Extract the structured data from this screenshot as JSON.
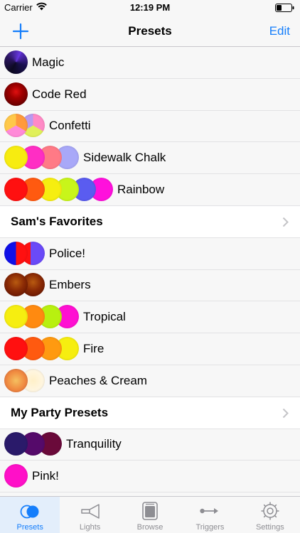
{
  "status_bar": {
    "carrier": "Carrier",
    "time": "12:19 PM"
  },
  "nav": {
    "title": "Presets",
    "edit_label": "Edit"
  },
  "colors": {
    "accent": "#157efb",
    "inactive": "#8e8e93"
  },
  "presets": [
    {
      "name": "Magic",
      "kind": "preset",
      "swatches": [
        {
          "css": "conic-gradient(from 30deg, #5a2cc6 0deg, #1a1050 80deg, #0d0a22 180deg, #2a155e 270deg, #6a3ae6 360deg)"
        }
      ]
    },
    {
      "name": "Code Red",
      "kind": "preset",
      "swatches": [
        {
          "css": "radial-gradient(circle at 50% 40%, #e01010 0%, #a00000 35%, #4a0000 100%)"
        }
      ]
    },
    {
      "name": "Confetti",
      "kind": "preset",
      "swatches": [
        {
          "css": "conic-gradient(#ff9a3c 0deg 120deg, #ff8ad8 120deg 240deg, #ffc84a 240deg 360deg)"
        },
        {
          "css": "conic-gradient(#ff8ac6 0deg 120deg, #e0f05a 120deg 240deg, #b89af0 240deg 360deg)"
        }
      ]
    },
    {
      "name": "Sidewalk Chalk",
      "kind": "preset",
      "swatches": [
        {
          "css": "#f7ec10"
        },
        {
          "css": "#ff2ec4"
        },
        {
          "css": "#ff7a86"
        },
        {
          "css": "#a8a8f8"
        }
      ]
    },
    {
      "name": "Rainbow",
      "kind": "preset",
      "swatches": [
        {
          "css": "#ff1010"
        },
        {
          "css": "#ff5a10"
        },
        {
          "css": "#f6ee10"
        },
        {
          "css": "#c8f51a"
        },
        {
          "css": "#5a5cf0"
        },
        {
          "css": "#ff10dc"
        }
      ]
    },
    {
      "name": "Sam's Favorites",
      "kind": "group"
    },
    {
      "name": "Police!",
      "kind": "preset",
      "swatches": [
        {
          "css": "linear-gradient(90deg, #1010e8 0%, #1010e8 50%, #ff1010 50%, #ff1010 100%)"
        },
        {
          "css": "linear-gradient(90deg, #ff1010 0%, #ff1010 40%, #6a4af8 40%, #6a4af8 100%)"
        }
      ]
    },
    {
      "name": "Embers",
      "kind": "preset",
      "swatches": [
        {
          "css": "radial-gradient(circle at 50% 40%, #b85a10 0%, #8a2a05 45%, #5a0f02 100%)"
        },
        {
          "css": "radial-gradient(circle at 50% 40%, #b85a10 0%, #8a2a05 45%, #5a0f02 100%)"
        }
      ]
    },
    {
      "name": "Tropical",
      "kind": "preset",
      "swatches": [
        {
          "css": "#f6ee10"
        },
        {
          "css": "#ff8a10"
        },
        {
          "css": "#b8f010"
        },
        {
          "css": "#ff10d2"
        }
      ]
    },
    {
      "name": "Fire",
      "kind": "preset",
      "swatches": [
        {
          "css": "#ff1010"
        },
        {
          "css": "#ff5a10"
        },
        {
          "css": "#ff9a10"
        },
        {
          "css": "#f6ee10"
        }
      ]
    },
    {
      "name": "Peaches & Cream",
      "kind": "preset",
      "swatches": [
        {
          "css": "radial-gradient(circle at 50% 50%, #f5c060 0%, #f08a40 55%, #e06a40 100%)"
        },
        {
          "css": "radial-gradient(circle at 50% 50%, #fff0c8 0%, #fff6e0 60%, #fff9ee 100%)"
        }
      ]
    },
    {
      "name": "My Party Presets",
      "kind": "group"
    },
    {
      "name": "Tranquility",
      "kind": "preset",
      "swatches": [
        {
          "css": "#2a1a6a"
        },
        {
          "css": "#550a6a"
        },
        {
          "css": "#6a0a3a"
        }
      ]
    },
    {
      "name": "Pink!",
      "kind": "preset",
      "swatches": [
        {
          "css": "#ff10c8"
        }
      ]
    }
  ],
  "tabs": [
    {
      "label": "Presets",
      "icon": "presets-icon",
      "active": true
    },
    {
      "label": "Lights",
      "icon": "light-icon",
      "active": false
    },
    {
      "label": "Browse",
      "icon": "browse-icon",
      "active": false
    },
    {
      "label": "Triggers",
      "icon": "triggers-icon",
      "active": false
    },
    {
      "label": "Settings",
      "icon": "gear-icon",
      "active": false
    }
  ]
}
